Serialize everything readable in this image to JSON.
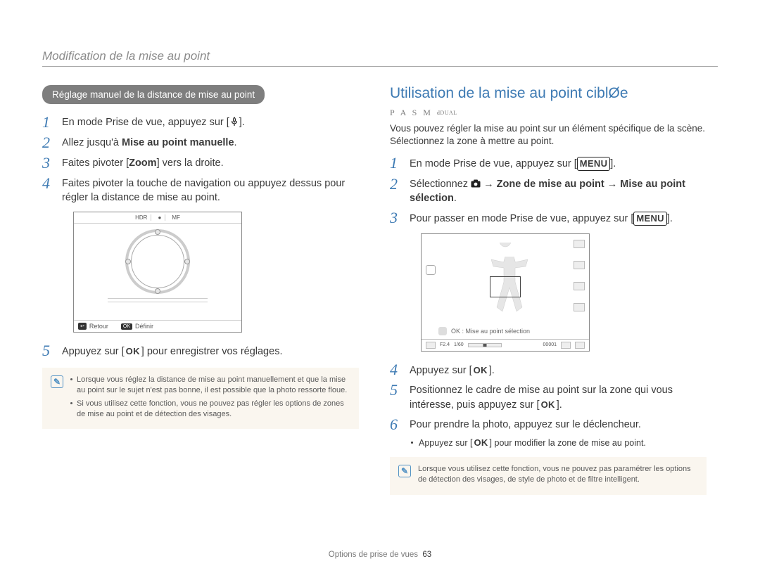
{
  "breadcrumb": "Modification de la mise au point",
  "left": {
    "pill": "Réglage manuel de la distance de mise au point",
    "steps": {
      "s1a": "En mode Prise de vue, appuyez sur [",
      "s1b": "].",
      "s2a": "Allez jusqu'à ",
      "s2b": "Mise au point manuelle",
      "s2c": ".",
      "s3a": "Faites pivoter [",
      "s3b": "Zoom",
      "s3c": "] vers la droite.",
      "s4": "Faites pivoter la touche de navigation ou appuyez dessus pour régler la distance de mise au point.",
      "s5a": "Appuyez sur [",
      "s5b": "] pour enregistrer vos réglages."
    },
    "illus": {
      "hdr_a": "HDR",
      "hdr_b": "●",
      "hdr_c": "MF",
      "back_key": "↩",
      "back_label": "Retour",
      "ok_key": "OK",
      "ok_label": "Définir"
    },
    "note": {
      "n1": "Lorsque vous réglez la distance de mise au point manuellement et que la mise au point sur le sujet n'est pas bonne, il est possible que la photo ressorte floue.",
      "n2": "Si vous utilisez cette fonction, vous ne pouvez pas régler les options de zones de mise au point et de détection des visages."
    }
  },
  "right": {
    "title": "Utilisation de la mise au point ciblØe",
    "modes": "P A S M ",
    "modes_dual": "dDUAL",
    "intro": "Vous pouvez régler la mise au point sur un élément spécifique de la scène. Sélectionnez la zone à mettre au point.",
    "steps": {
      "s1a": "En mode Prise de vue, appuyez sur [",
      "s1b": "].",
      "s2a": "Sélectionnez ",
      "s2b": " → ",
      "s2c": "Zone de mise au point",
      "s2d": " → ",
      "s2e": "Mise au point sélection",
      "s2f": ".",
      "s3a": "Pour passer en mode Prise de vue, appuyez sur [",
      "s3b": "].",
      "s4a": "Appuyez sur [",
      "s4b": "].",
      "s5a": "Positionnez le cadre de mise au point sur la zone qui vous intéresse, puis appuyez sur [",
      "s5b": "].",
      "s6": "Pour prendre la photo, appuyez sur le déclencheur.",
      "sub_a": "Appuyez sur [",
      "sub_b": "] pour modifier la zone de mise au point."
    },
    "illus": {
      "hint": "OK : Mise au point sélection",
      "f": "F2.4",
      "sh": "1/60",
      "cnt": "00001"
    },
    "note": "Lorsque vous utilisez cette fonction, vous ne pouvez pas paramétrer les options de détection des visages, de style de photo et de filtre intelligent."
  },
  "footer": {
    "section": "Options de prise de vues",
    "page": "63"
  }
}
